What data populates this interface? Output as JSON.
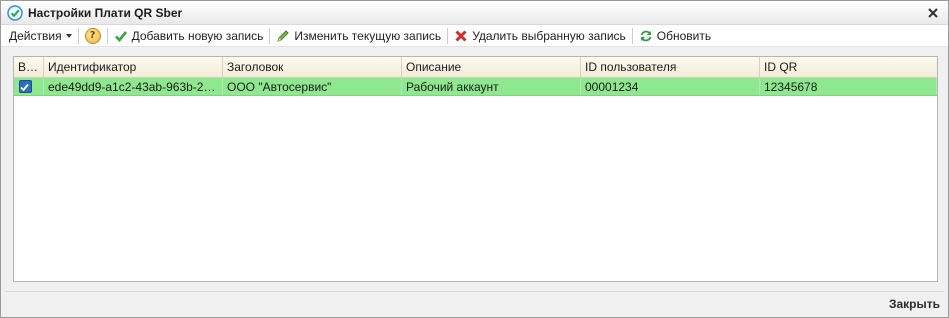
{
  "window": {
    "title": "Настройки Плати QR Sber"
  },
  "toolbar": {
    "actions_label": "Действия",
    "help_label": "?",
    "add_label": "Добавить новую запись",
    "edit_label": "Изменить текущую запись",
    "delete_label": "Удалить выбранную запись",
    "refresh_label": "Обновить"
  },
  "table": {
    "columns": [
      "Вы...",
      "Идентификатор",
      "Заголовок",
      "Описание",
      "ID пользователя",
      "ID QR"
    ],
    "rows": [
      {
        "selected": true,
        "identifier": "ede49dd9-a1c2-43ab-963b-22478...",
        "title": "ООО \"Автосервис\"",
        "description": "Рабочий аккаунт",
        "user_id": "00001234",
        "qr_id": "12345678"
      }
    ]
  },
  "footer": {
    "close_label": "Закрыть"
  },
  "colors": {
    "selected_row": "#8fe88f",
    "header_bg": "#f2ecd8",
    "accent_green": "#3aa33a",
    "delete_red": "#d42a2a"
  }
}
